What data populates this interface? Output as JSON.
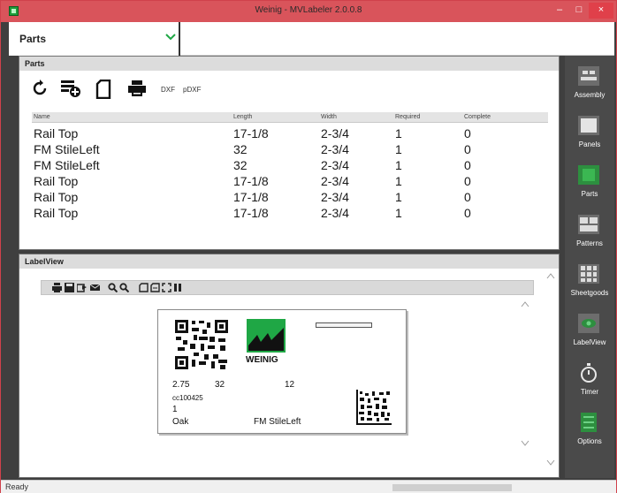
{
  "window": {
    "title": "Weinig - MVLabeler 2.0.0.8",
    "minimize_glyph": "–",
    "maximize_glyph": "□",
    "close_glyph": "×"
  },
  "module_selector": {
    "selected": "Parts"
  },
  "parts_panel": {
    "title": "Parts",
    "toolbar": {
      "dxf_label": "DXF",
      "pdxf_label": "pDXF"
    },
    "columns": [
      "Name",
      "Length",
      "Width",
      "Required",
      "Complete"
    ],
    "rows": [
      [
        "Rail Top",
        "17-1/8",
        "2-3/4",
        "1",
        "0"
      ],
      [
        "FM StileLeft",
        "32",
        "2-3/4",
        "1",
        "0"
      ],
      [
        "FM StileLeft",
        "32",
        "2-3/4",
        "1",
        "0"
      ],
      [
        "Rail Top",
        "17-1/8",
        "2-3/4",
        "1",
        "0"
      ],
      [
        "Rail Top",
        "17-1/8",
        "2-3/4",
        "1",
        "0"
      ],
      [
        "Rail Top",
        "17-1/8",
        "2-3/4",
        "1",
        "0"
      ]
    ]
  },
  "label_view": {
    "title": "LabelView",
    "label": {
      "brand": "WEINIG",
      "width": "2.75",
      "length": "32",
      "number": "12",
      "code": "cc100425",
      "quantity": "1",
      "material": "Oak",
      "part_name": "FM StileLeft"
    }
  },
  "sidebar": {
    "items": [
      {
        "label": "Assembly",
        "icon": "assembly-icon"
      },
      {
        "label": "Panels",
        "icon": "panels-icon"
      },
      {
        "label": "Parts",
        "icon": "parts-icon"
      },
      {
        "label": "Patterns",
        "icon": "patterns-icon"
      },
      {
        "label": "Sheetgoods",
        "icon": "sheetgoods-icon"
      },
      {
        "label": "LabelView",
        "icon": "labelview-icon"
      },
      {
        "label": "Timer",
        "icon": "timer-icon"
      },
      {
        "label": "Options",
        "icon": "options-icon"
      }
    ]
  },
  "status": {
    "text": "Ready"
  },
  "colors": {
    "titlebar": "#d9545b",
    "accent_green": "#1fa745",
    "sidebar": "#4a4a4a"
  }
}
